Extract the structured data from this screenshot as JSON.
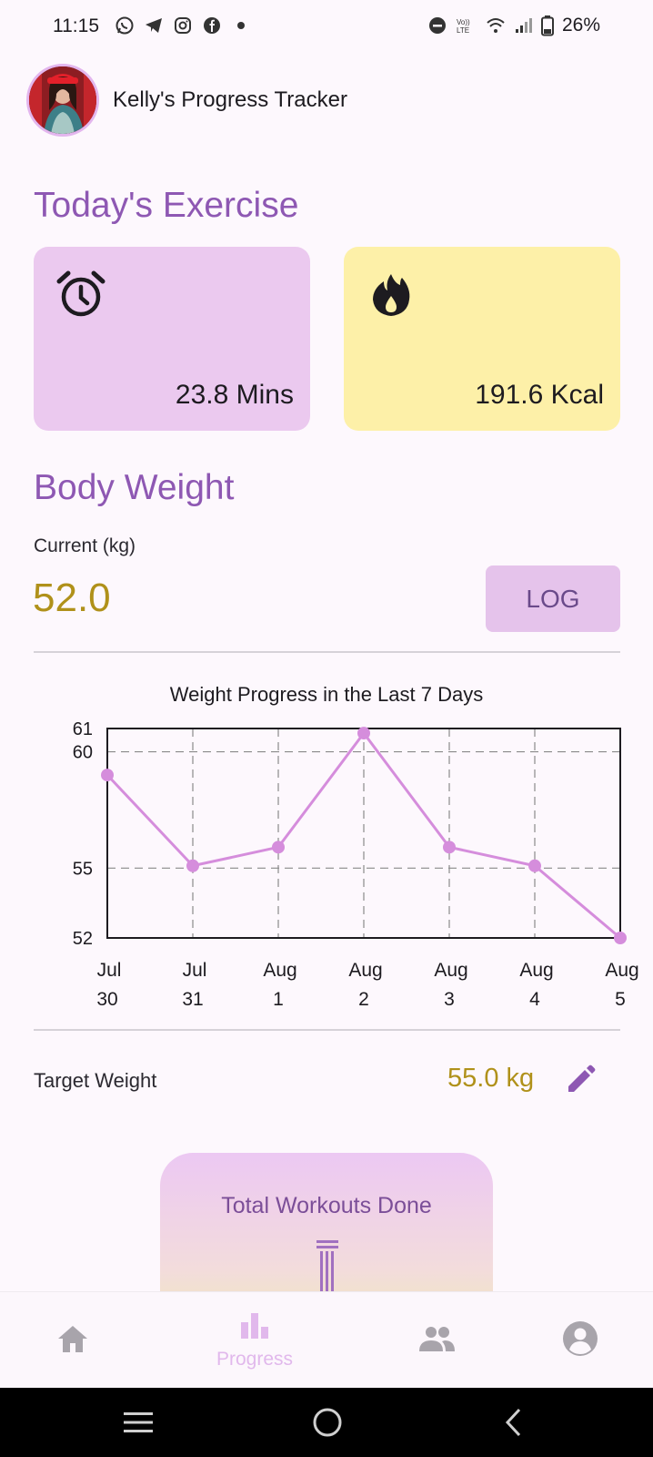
{
  "status_bar": {
    "time": "11:15",
    "battery": "26%",
    "left_icons": [
      "whatsapp-icon",
      "telegram-icon",
      "instagram-icon",
      "facebook-icon",
      "dot-icon"
    ],
    "right_icons": [
      "dnd-icon",
      "volte-icon",
      "wifi-icon",
      "signal-icon",
      "battery-icon"
    ]
  },
  "header": {
    "title": "Kelly's Progress Tracker"
  },
  "today_exercise": {
    "title": "Today's Exercise",
    "time_card": {
      "icon": "alarm-clock-icon",
      "value": "23.8 Mins",
      "color": "#ebc9ef"
    },
    "kcal_card": {
      "icon": "fire-icon",
      "value": "191.6 Kcal",
      "color": "#fdf0a8"
    }
  },
  "body_weight": {
    "title": "Body Weight",
    "current_label": "Current (kg)",
    "current_value": "52.0",
    "log_label": "LOG",
    "target_label": "Target Weight",
    "target_value": "55.0 kg",
    "value_color": "#b0911a"
  },
  "chart_data": {
    "type": "line",
    "title": "Weight Progress in the Last 7 Days",
    "categories": [
      [
        "Jul",
        "30"
      ],
      [
        "Jul",
        "31"
      ],
      [
        "Aug",
        "1"
      ],
      [
        "Aug",
        "2"
      ],
      [
        "Aug",
        "3"
      ],
      [
        "Aug",
        "4"
      ],
      [
        "Aug",
        "5"
      ]
    ],
    "series": [
      {
        "values": [
          59.0,
          55.1,
          55.9,
          60.8,
          55.9,
          55.1,
          52.0
        ],
        "color": "#d58ddc"
      }
    ],
    "y_ticks": [
      52,
      55,
      60,
      61
    ],
    "ylim": [
      52,
      61
    ],
    "grid": true
  },
  "workouts": {
    "title": "Total Workouts Done"
  },
  "bottom_nav": {
    "items": [
      {
        "icon": "home-icon",
        "label": ""
      },
      {
        "icon": "bar-chart-icon",
        "label": "Progress"
      },
      {
        "icon": "group-icon",
        "label": ""
      },
      {
        "icon": "account-icon",
        "label": ""
      }
    ],
    "active_color": "#e1b8ec",
    "inactive_color": "#a8a4ab"
  },
  "system_nav": {
    "buttons": [
      "recents-icon",
      "home-circle-icon",
      "back-icon"
    ]
  }
}
